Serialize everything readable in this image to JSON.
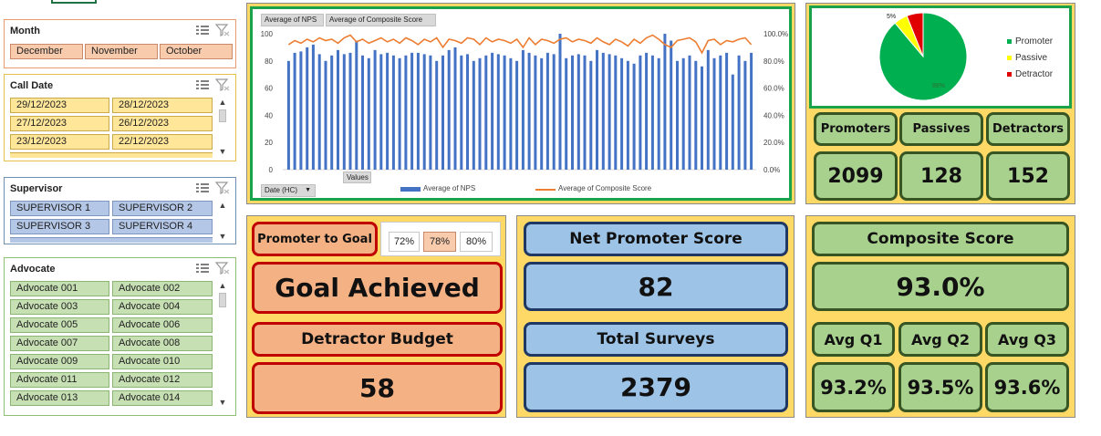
{
  "slicers": {
    "month": {
      "title": "Month",
      "items": [
        "December",
        "November",
        "October"
      ]
    },
    "call_date": {
      "title": "Call Date",
      "items": [
        "29/12/2023",
        "28/12/2023",
        "27/12/2023",
        "26/12/2023",
        "23/12/2023",
        "22/12/2023"
      ]
    },
    "supervisor": {
      "title": "Supervisor",
      "items": [
        "SUPERVISOR 1",
        "SUPERVISOR 2",
        "SUPERVISOR 3",
        "SUPERVISOR 4"
      ]
    },
    "advocate": {
      "title": "Advocate",
      "items": [
        "Advocate 001",
        "Advocate 002",
        "Advocate 003",
        "Advocate 004",
        "Advocate 005",
        "Advocate 006",
        "Advocate 007",
        "Advocate 008",
        "Advocate 009",
        "Advocate 010",
        "Advocate 011",
        "Advocate 012",
        "Advocate 013",
        "Advocate 014"
      ]
    }
  },
  "combo_chart": {
    "field_buttons": [
      "Average of NPS",
      "Average of Composite Score"
    ],
    "values_button": "Values",
    "axis_filter": "Date (HC)",
    "legend": [
      "Average of NPS",
      "Average of Composite Score"
    ],
    "left_ticks": [
      "0",
      "20",
      "40",
      "60",
      "80",
      "100"
    ],
    "right_ticks": [
      "0.0%",
      "20.0%",
      "40.0%",
      "60.0%",
      "80.0%",
      "100.0%"
    ],
    "colors": {
      "nps": "#4472c4",
      "composite": "#ed7d31"
    }
  },
  "chart_data": [
    {
      "type": "bar+line",
      "ylim": [
        0,
        100
      ],
      "y2lim": [
        0,
        1
      ],
      "series": [
        {
          "name": "Average of NPS",
          "axis": "left",
          "values": [
            80,
            86,
            87,
            90,
            92,
            85,
            80,
            84,
            88,
            85,
            86,
            95,
            84,
            82,
            88,
            85,
            86,
            84,
            82,
            84,
            86,
            86,
            85,
            84,
            80,
            84,
            88,
            90,
            84,
            85,
            80,
            82,
            84,
            86,
            85,
            84,
            82,
            80,
            88,
            86,
            84,
            82,
            86,
            85,
            100,
            82,
            84,
            85,
            84,
            80,
            88,
            86,
            85,
            84,
            82,
            80,
            78,
            84,
            86,
            84,
            82,
            100,
            95,
            80,
            82,
            84,
            80,
            76,
            88,
            82,
            84,
            86,
            70,
            84,
            80,
            86
          ]
        },
        {
          "name": "Average of Composite Score",
          "axis": "right",
          "values": [
            0.92,
            0.95,
            0.93,
            0.96,
            0.94,
            0.97,
            0.95,
            0.96,
            0.93,
            0.97,
            0.99,
            0.94,
            0.96,
            0.93,
            0.95,
            0.97,
            0.94,
            0.96,
            0.93,
            0.97,
            0.95,
            0.92,
            0.96,
            0.94,
            0.97,
            0.9,
            0.96,
            0.95,
            0.93,
            0.97,
            0.96,
            0.92,
            0.97,
            0.94,
            0.96,
            0.95,
            0.93,
            0.96,
            0.9,
            0.97,
            0.92,
            0.96,
            0.95,
            0.93,
            0.96,
            0.97,
            0.94,
            0.96,
            0.95,
            0.93,
            0.97,
            0.94,
            0.92,
            0.96,
            0.94,
            0.91,
            0.96,
            0.93,
            0.97,
            0.99,
            0.96,
            0.92,
            0.9,
            0.95,
            0.96,
            0.97,
            0.94,
            0.86,
            0.95,
            0.96,
            0.92,
            0.95,
            0.94,
            0.96,
            0.97,
            0.92
          ]
        }
      ]
    },
    {
      "type": "pie",
      "labels": [
        "Promoter",
        "Passive",
        "Detractor"
      ],
      "values": [
        88,
        5,
        6
      ],
      "data_labels": [
        "88%",
        "5%",
        ""
      ],
      "colors": [
        "#00b050",
        "#ffff00",
        "#e00000"
      ],
      "legend": "right"
    }
  ],
  "kpi": {
    "promoters_label": "Promoters",
    "passives_label": "Passives",
    "detractors_label": "Detractors",
    "promoters_value": "2099",
    "passives_value": "128",
    "detractors_value": "152",
    "promoter_to_goal_label": "Promoter to Goal",
    "goal_options": [
      "72%",
      "78%",
      "80%"
    ],
    "goal_selected": "78%",
    "goal_status": "Goal Achieved",
    "detractor_budget_label": "Detractor Budget",
    "detractor_budget_value": "58",
    "nps_label": "Net Promoter Score",
    "nps_value": "82",
    "total_surveys_label": "Total Surveys",
    "total_surveys_value": "2379",
    "composite_label": "Composite Score",
    "composite_value": "93.0%",
    "q1_label": "Avg Q1",
    "q2_label": "Avg Q2",
    "q3_label": "Avg Q3",
    "q1_value": "93.2%",
    "q2_value": "93.5%",
    "q3_value": "93.6%"
  }
}
